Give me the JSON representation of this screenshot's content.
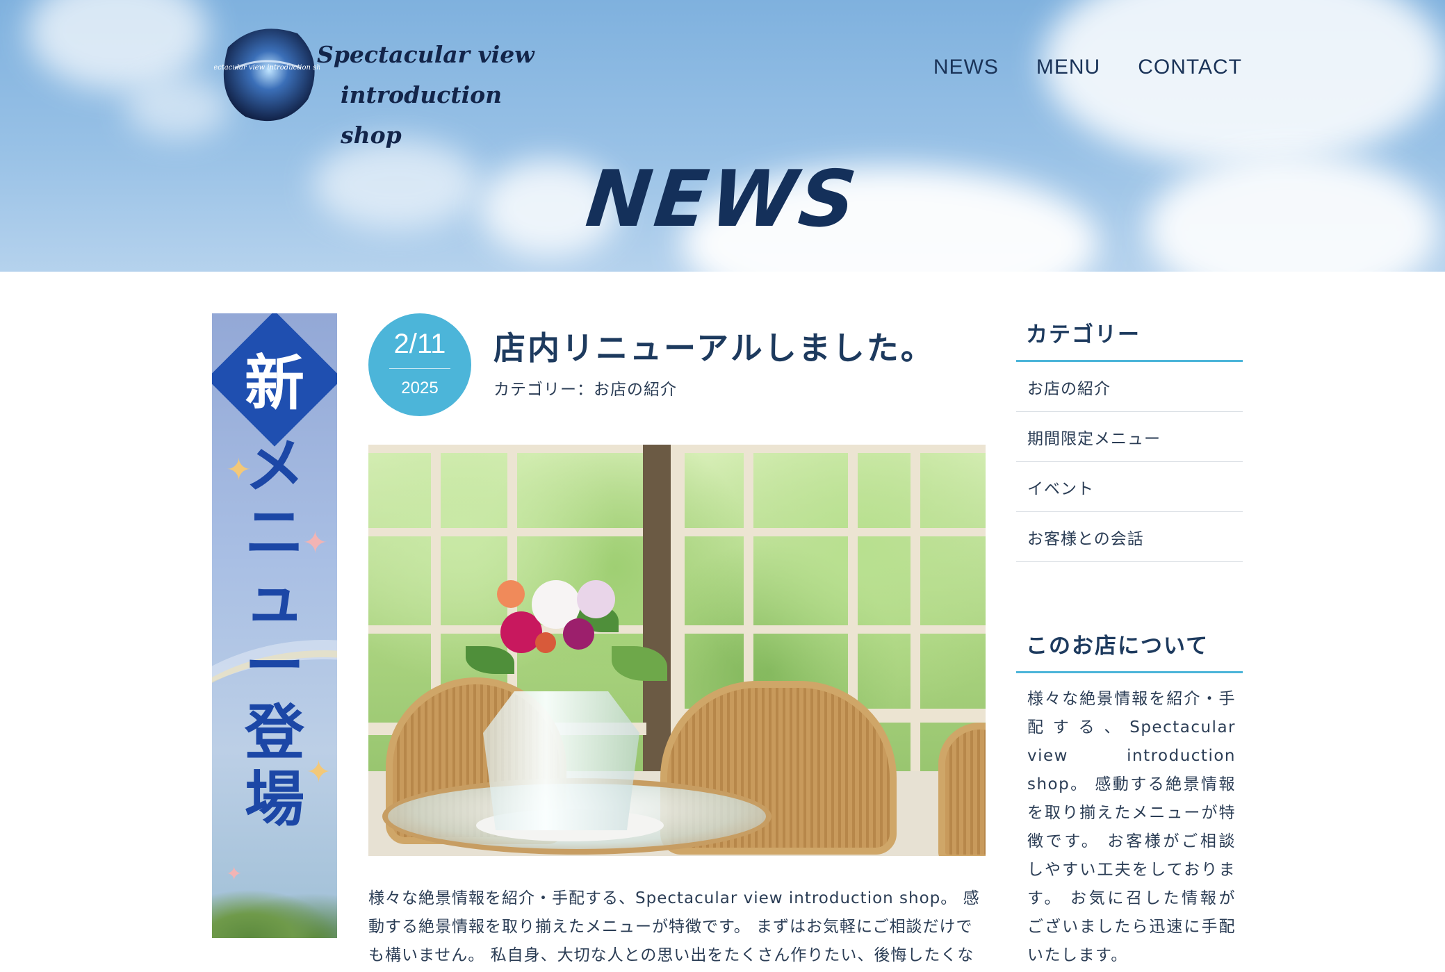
{
  "site": {
    "logo_line1": "Spectacular view",
    "logo_line2": "introduction shop",
    "logo_badge_text": "Spectacular view introduction shop"
  },
  "nav": [
    {
      "label": "NEWS"
    },
    {
      "label": "MENU"
    },
    {
      "label": "CONTACT"
    }
  ],
  "hero": {
    "title": "NEWS"
  },
  "banner": {
    "badge": "新",
    "chars": [
      "メ",
      "ニ",
      "ュ",
      "ー",
      "登",
      "場"
    ]
  },
  "post": {
    "date_md": "2/11",
    "date_year": "2025",
    "title": "店内リニューアルしました。",
    "category": "カテゴリー：お店の紹介",
    "body": "様々な絶景情報を紹介・手配する、Spectacular view introduction shop。 感動する絶景情報を取り揃えたメニューが特徴です。 まずはお気軽にご相談だけでも構いません。 私自身、大切な人との思い出をたくさん作りたい、後悔したくないと"
  },
  "sidebar": {
    "categories_title": "カテゴリー",
    "categories": [
      {
        "label": "お店の紹介"
      },
      {
        "label": "期間限定メニュー"
      },
      {
        "label": "イベント"
      },
      {
        "label": "お客様との会話"
      }
    ],
    "about_title": "このお店について",
    "about_text": "様々な絶景情報を紹介・手配する、Spectacular view introduction shop。 感動する絶景情報を取り揃えたメニューが特徴です。 お客様がご相談しやすい工夫をしております。 お気に召した情報がございましたら迅速に手配いたします。"
  },
  "colors": {
    "accent": "#4cb5d9",
    "navy": "#1d3a5e",
    "banner_blue": "#1f4fb0"
  }
}
